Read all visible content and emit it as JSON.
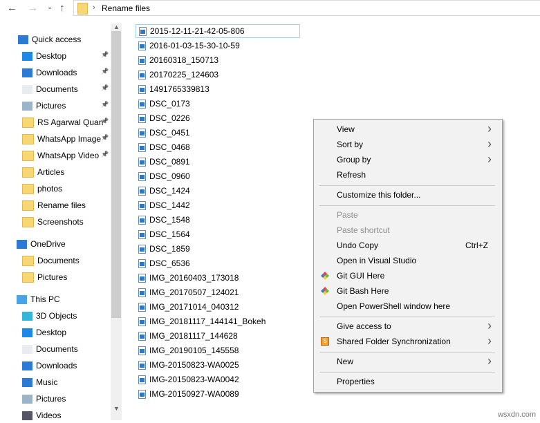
{
  "nav": {
    "back": "←",
    "forward": "→",
    "recent": "⌄",
    "up": "↑",
    "path_sep": "›",
    "path": "Rename files"
  },
  "sidebar": {
    "quick_access": "Quick access",
    "quick_items": [
      {
        "label": "Desktop",
        "pinned": true
      },
      {
        "label": "Downloads",
        "pinned": true
      },
      {
        "label": "Documents",
        "pinned": true
      },
      {
        "label": "Pictures",
        "pinned": true
      },
      {
        "label": "RS Agarwal Quan",
        "pinned": true
      },
      {
        "label": "WhatsApp Image",
        "pinned": true
      },
      {
        "label": "WhatsApp Video",
        "pinned": true
      },
      {
        "label": "Articles"
      },
      {
        "label": "photos"
      },
      {
        "label": "Rename files"
      },
      {
        "label": "Screenshots"
      }
    ],
    "onedrive": "OneDrive",
    "onedrive_items": [
      "Documents",
      "Pictures"
    ],
    "this_pc": "This PC",
    "pc_items": [
      "3D Objects",
      "Desktop",
      "Documents",
      "Downloads",
      "Music",
      "Pictures",
      "Videos"
    ]
  },
  "files": [
    "2015-12-11-21-42-05-806",
    "2016-01-03-15-30-10-59",
    "20160318_150713",
    "20170225_124603",
    "1491765339813",
    "DSC_0173",
    "DSC_0226",
    "DSC_0451",
    "DSC_0468",
    "DSC_0891",
    "DSC_0960",
    "DSC_1424",
    "DSC_1442",
    "DSC_1548",
    "DSC_1564",
    "DSC_1859",
    "DSC_6536",
    "IMG_20160403_173018",
    "IMG_20170507_124021",
    "IMG_20171014_040312",
    "IMG_20181117_144141_Bokeh",
    "IMG_20181117_144628",
    "IMG_20190105_145558",
    "IMG-20150823-WA0025",
    "IMG-20150823-WA0042",
    "IMG-20150927-WA0089"
  ],
  "menu": {
    "view": "View",
    "sort_by": "Sort by",
    "group_by": "Group by",
    "refresh": "Refresh",
    "customize": "Customize this folder...",
    "paste": "Paste",
    "paste_shortcut": "Paste shortcut",
    "undo_copy": "Undo Copy",
    "undo_shortcut": "Ctrl+Z",
    "open_vs": "Open in Visual Studio",
    "git_gui": "Git GUI Here",
    "git_bash": "Git Bash Here",
    "powershell": "Open PowerShell window here",
    "give_access": "Give access to",
    "shared_sync": "Shared Folder Synchronization",
    "new": "New",
    "properties": "Properties"
  },
  "watermark": "wsxdn.com"
}
